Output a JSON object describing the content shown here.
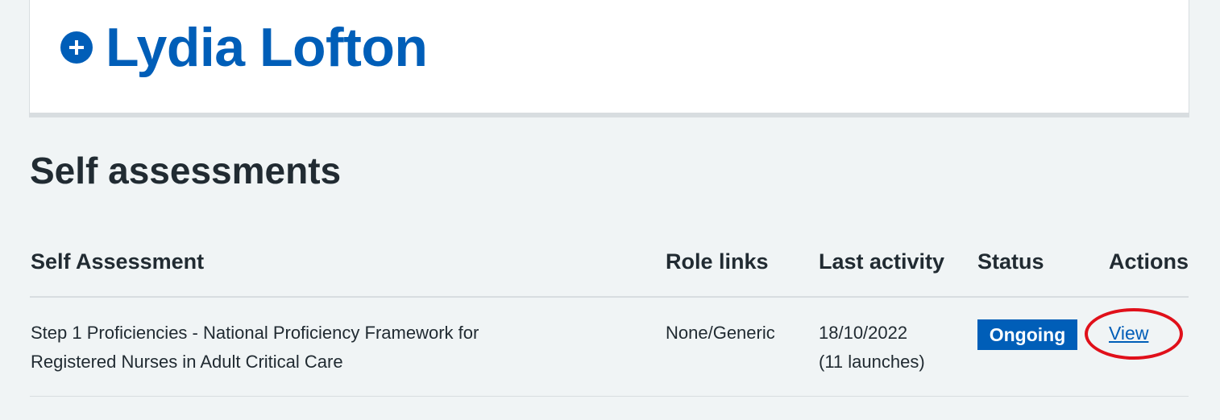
{
  "learner": {
    "name": "Lydia Lofton",
    "expand_icon": "plus-circle-icon"
  },
  "section": {
    "title": "Self assessments"
  },
  "table": {
    "headers": [
      "Self Assessment",
      "Role links",
      "Last activity",
      "Status",
      "Actions"
    ],
    "rows": [
      {
        "self_assessment_line1": "Step 1 Proficiencies - National Proficiency Framework for",
        "self_assessment_line2": "Registered Nurses in Adult Critical Care",
        "role_links": "None/Generic",
        "last_activity_date": "18/10/2022",
        "last_activity_launches": "(11 launches)",
        "status": "Ongoing",
        "action": "View"
      }
    ]
  },
  "colors": {
    "brand": "#005eb8",
    "annotation": "#e0101a",
    "background": "#f0f4f5"
  }
}
